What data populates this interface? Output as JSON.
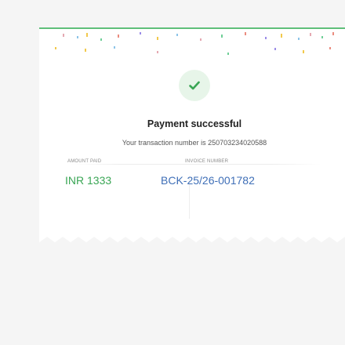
{
  "receipt": {
    "title": "Payment successful",
    "transaction_text": "Your transaction number is 250703234020588",
    "amount_label": "AMOUNT PAID",
    "amount_value": "INR 1333",
    "invoice_label": "INVOICE NUMBER",
    "invoice_value": "BCK-25/26-001782",
    "icon": "check-icon"
  },
  "colors": {
    "success_green": "#3aa655",
    "invoice_blue": "#3f6fb7",
    "check_circle_bg": "#e7f5e9"
  }
}
